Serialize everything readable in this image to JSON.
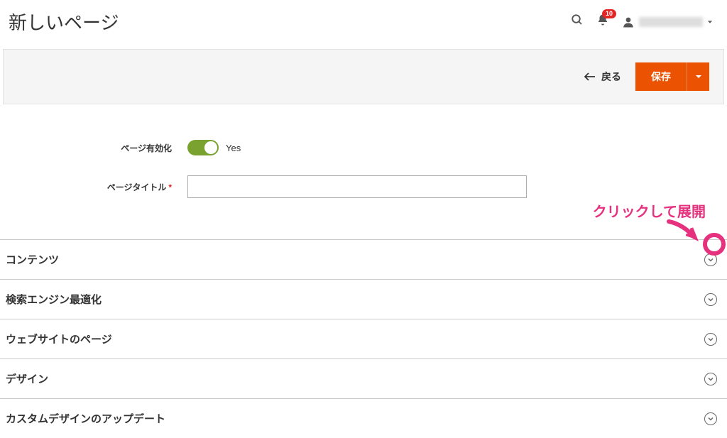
{
  "header": {
    "page_title": "新しいページ",
    "notif_count": "10"
  },
  "toolbar": {
    "back_label": "戻る",
    "save_label": "保存"
  },
  "form": {
    "enable_label": "ページ有効化",
    "enable_value": "Yes",
    "title_label": "ページタイトル",
    "title_value": ""
  },
  "sections": [
    {
      "label": "コンテンツ"
    },
    {
      "label": "検索エンジン最適化"
    },
    {
      "label": "ウェブサイトのページ"
    },
    {
      "label": "デザイン"
    },
    {
      "label": "カスタムデザインのアップデート"
    }
  ],
  "annotation": {
    "text": "クリックして展開"
  }
}
